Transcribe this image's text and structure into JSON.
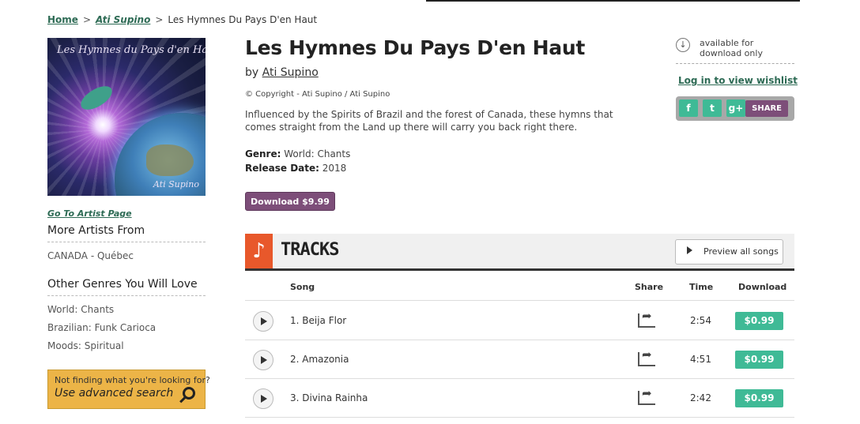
{
  "breadcrumb": {
    "home": "Home",
    "artist": "Ati Supino",
    "current": "Les Hymnes Du Pays D'en Haut",
    "sep": ">"
  },
  "cover": {
    "title_text": "Les Hymnes du Pays d'en Haut",
    "artist_text": "Ati Supino"
  },
  "sidebar": {
    "artist_page": "Go To Artist Page",
    "more_artists_heading": "More Artists From",
    "more_artists": [
      "CANADA - Québec"
    ],
    "genres_heading": "Other Genres You Will Love",
    "genres": [
      "World: Chants",
      "Brazilian: Funk Carioca",
      "Moods: Spiritual"
    ],
    "search_prompt": "Not finding what you're looking for?",
    "search_link": "Use advanced search"
  },
  "album": {
    "title": "Les Hymnes Du Pays D'en Haut",
    "by_prefix": "by",
    "artist": "Ati Supino",
    "copyright": "© Copyright - Ati Supino / Ati Supino",
    "description": "Influenced by the Spirits of Brazil and the forest of Canada, these hymns that comes straight from the Land up there will carry you back right there.",
    "genre_label": "Genre:",
    "genre_value": "World: Chants",
    "release_label": "Release Date:",
    "release_value": "2018",
    "download_button": "Download $9.99"
  },
  "rightbox": {
    "availability": "available for download only",
    "wishlist": "Log in to view wishlist",
    "share_buttons": [
      "f",
      "t",
      "g+"
    ],
    "share_label": "SHARE"
  },
  "tracks": {
    "heading": "TRACKS",
    "preview_all": "Preview all songs",
    "columns": {
      "song": "Song",
      "share": "Share",
      "time": "Time",
      "download": "Download"
    },
    "rows": [
      {
        "title": "1. Beija Flor",
        "time": "2:54",
        "price": "$0.99"
      },
      {
        "title": "2. Amazonia",
        "time": "4:51",
        "price": "$0.99"
      },
      {
        "title": "3. Divina Rainha",
        "time": "2:42",
        "price": "$0.99"
      }
    ]
  }
}
